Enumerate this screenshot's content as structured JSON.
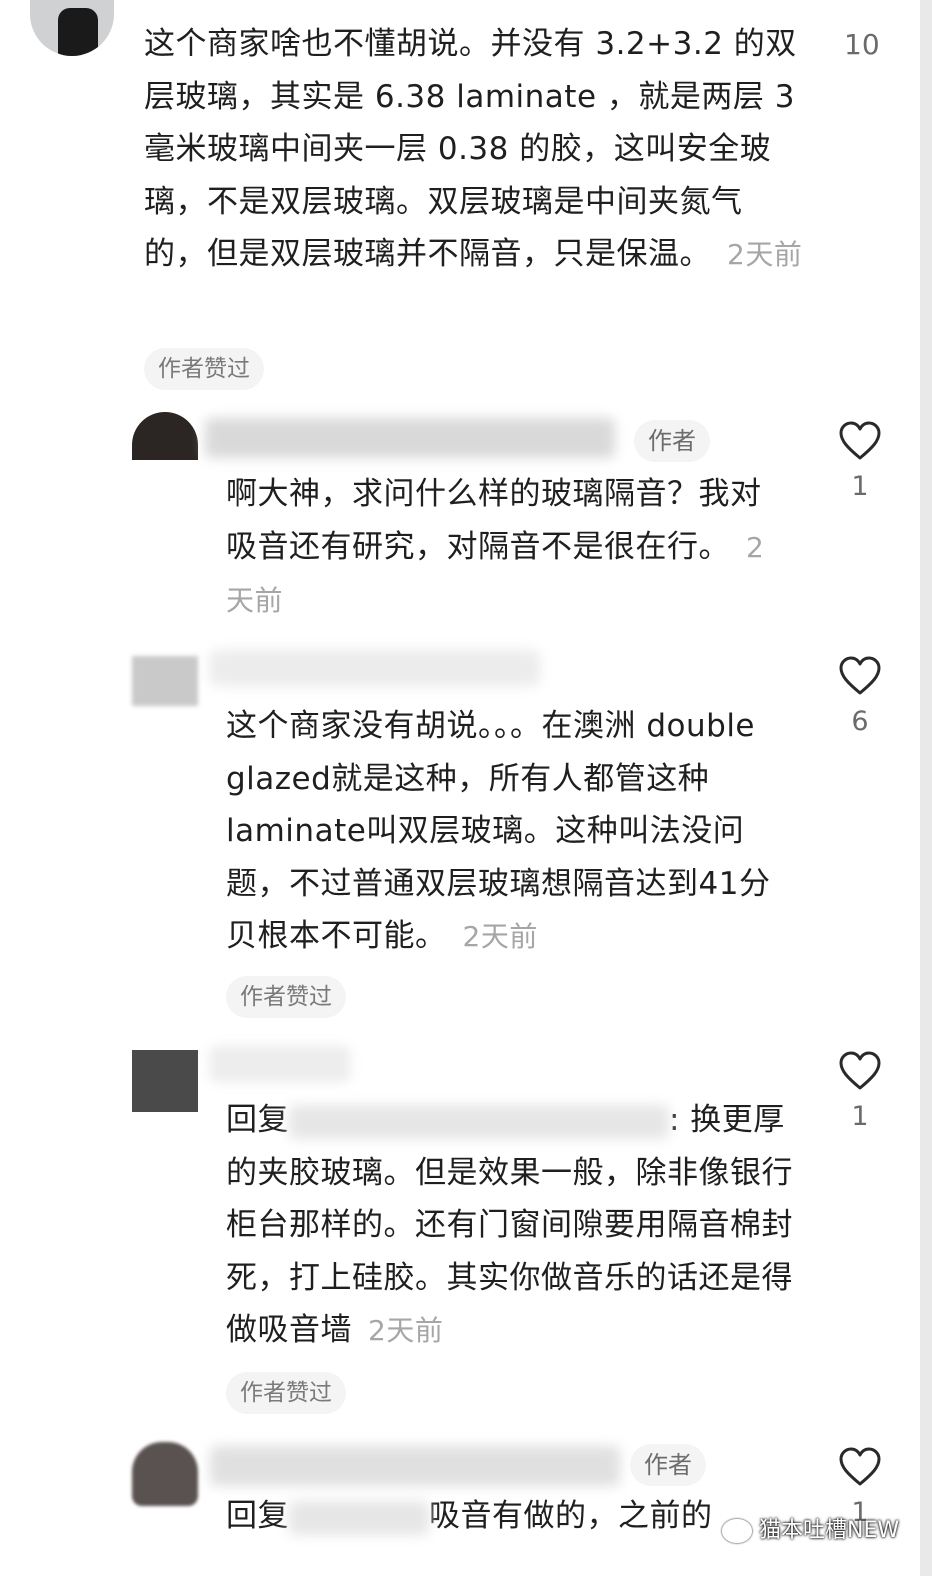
{
  "comments": [
    {
      "text": "这个商家啥也不懂胡说。并没有 3.2+3.2 的双层玻璃，其实是 6.38 laminate ，就是两层 3 毫米玻璃中间夹一层 0.38 的胶，这叫安全玻璃，不是双层玻璃。双层玻璃是中间夹氮气的，但是双层玻璃并不隔音，只是保温。",
      "time": "2天前",
      "likes": "10",
      "badge": "作者赞过"
    },
    {
      "author_badge": "作者",
      "text": "啊大神，求问什么样的玻璃隔音？我对吸音还有研究，对隔音不是很在行。",
      "time": "2天前",
      "likes": "1"
    },
    {
      "text": "这个商家没有胡说。。。在澳洲 double glazed就是这种，所有人都管这种laminate叫双层玻璃。这种叫法没问题，不过普通双层玻璃想隔音达到41分贝根本不可能。",
      "time": "2天前",
      "likes": "6",
      "badge": "作者赞过"
    },
    {
      "reply_prefix": "回复",
      "text": ": 换更厚的夹胶玻璃。但是效果一般，除非像银行柜台那样的。还有门窗间隙要用隔音棉封死，打上硅胶。其实你做音乐的话还是得做吸音墙",
      "time": "2天前",
      "likes": "1",
      "badge": "作者赞过"
    },
    {
      "author_badge": "作者",
      "text_start": "回复",
      "text": "吸音有做的，之前的",
      "likes": "1"
    }
  ],
  "watermark": "猫本吐槽NEW",
  "colors": {
    "text": "#1f1f1f",
    "muted": "#a6a6a6",
    "pill_bg": "#f4f4f4"
  },
  "icons": [
    "heart-outline-icon",
    "wechat-icon"
  ]
}
